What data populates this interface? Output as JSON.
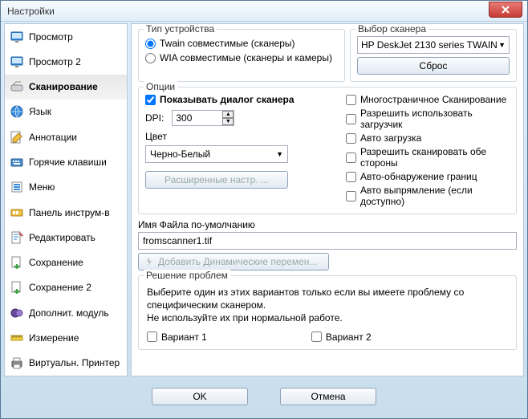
{
  "window": {
    "title": "Настройки",
    "close": "X"
  },
  "sidebar": {
    "items": [
      {
        "label": "Просмотр"
      },
      {
        "label": "Просмотр 2"
      },
      {
        "label": "Сканирование"
      },
      {
        "label": "Язык"
      },
      {
        "label": "Аннотации"
      },
      {
        "label": "Горячие клавиши"
      },
      {
        "label": "Меню"
      },
      {
        "label": "Панель инструм-в"
      },
      {
        "label": "Редактировать"
      },
      {
        "label": "Сохранение"
      },
      {
        "label": "Сохранение 2"
      },
      {
        "label": "Дополнит. модуль"
      },
      {
        "label": "Измерение"
      },
      {
        "label": "Виртуальн. Принтер"
      }
    ]
  },
  "device": {
    "legend": "Тип устройства",
    "twain": "Twain совместимые (сканеры)",
    "wia": "WIA совместимые (сканеры и камеры)"
  },
  "scanner": {
    "legend": "Выбор сканера",
    "selected": "HP DeskJet 2130 series TWAIN",
    "reset": "Сброс"
  },
  "options": {
    "legend": "Опции",
    "show_dialog": "Показывать диалог сканера",
    "dpi_label": "DPI:",
    "dpi_value": "300",
    "color_label": "Цвет",
    "color_value": "Черно-Белый",
    "advanced": "Расширенные настр. ...",
    "multi_page": "Многостраничное Сканирование",
    "use_feeder": "Разрешить использовать загрузчик",
    "auto_load": "Авто загрузка",
    "scan_both": "Разрешить сканировать обе стороны",
    "auto_edge": "Авто-обнаружение границ",
    "auto_deskew": "Авто выпрямление (если доступно)"
  },
  "filename": {
    "label": "Имя Файла по-умолчанию",
    "value": "fromscanner1.tif",
    "dyn": "Добавить Динамические перемен..."
  },
  "trouble": {
    "legend": "Решение проблем",
    "text1": "Выберите один из этих вариантов только если вы имеете проблему со специфическим сканером.",
    "text2": "Не используйте их при нормальной работе.",
    "opt1": "Вариант 1",
    "opt2": "Вариант 2"
  },
  "footer": {
    "ok": "OK",
    "cancel": "Отмена"
  }
}
